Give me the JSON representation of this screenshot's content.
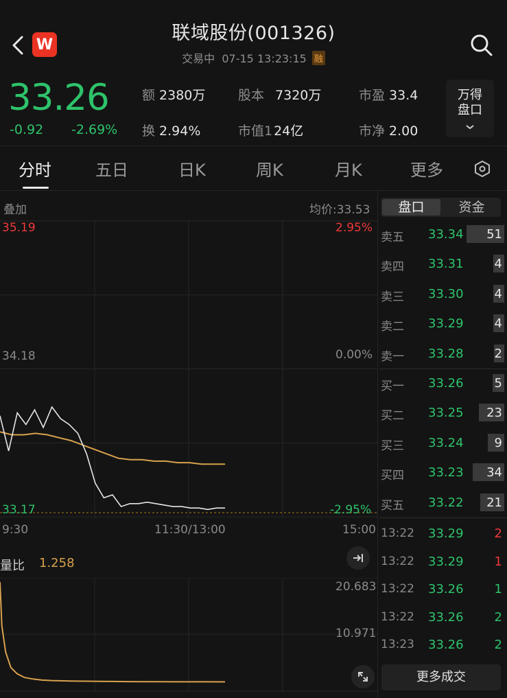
{
  "header": {
    "title": "联域股份(001326)",
    "status": "交易中",
    "datetime": "07-15 13:23:15",
    "margin_badge": "融",
    "logo_letter": "W"
  },
  "quote": {
    "price": "33.26",
    "change": "-0.92",
    "change_pct": "-2.69%",
    "stats": [
      {
        "label": "额",
        "value": "2380万"
      },
      {
        "label": "股本",
        "value": "7320万"
      },
      {
        "label": "市盈",
        "value": "33.4"
      },
      {
        "label": "换",
        "value": "2.94%"
      },
      {
        "label": "市值1",
        "value": "24亿"
      },
      {
        "label": "市净",
        "value": "2.00"
      }
    ],
    "pankou_button": {
      "line1": "万得",
      "line2": "盘口"
    }
  },
  "tabs": [
    "分时",
    "五日",
    "日K",
    "周K",
    "月K",
    "更多"
  ],
  "intraday": {
    "overlay_label": "叠加",
    "avg_price": "均价:33.53",
    "y_max": "35.19",
    "y_mid": "34.18",
    "y_min": "33.17",
    "pct_max": "2.95%",
    "pct_mid": "0.00%",
    "pct_min": "-2.95%",
    "time_start": "9:30",
    "time_mid": "11:30/13:00",
    "time_end": "15:00",
    "volume_ratio_label": "量比",
    "volume_ratio_value": "1.258",
    "vr_max": "20.683",
    "vr_mid": "10.971"
  },
  "chart_data": {
    "type": "line",
    "ylim": [
      33.17,
      35.19
    ],
    "series": [
      {
        "values": [
          33.86,
          33.62,
          33.88,
          33.8,
          33.9,
          33.78,
          33.92,
          33.84,
          33.8,
          33.74,
          33.6,
          33.4,
          33.3,
          33.32,
          33.24,
          33.26,
          33.26,
          33.27,
          33.26,
          33.25,
          33.24,
          33.24,
          33.23,
          33.23,
          33.22,
          33.23,
          33.23
        ]
      },
      {
        "values": [
          33.75,
          33.73,
          33.73,
          33.74,
          33.73,
          33.71,
          33.69,
          33.66,
          33.63,
          33.6,
          33.57,
          33.56,
          33.56,
          33.55,
          33.55,
          33.54,
          33.54,
          33.53,
          33.53,
          33.53
        ]
      }
    ],
    "volume_ratio": [
      20.4,
      12.0,
      7.0,
      4.0,
      2.8,
      2.1,
      1.8,
      1.6,
      1.5,
      1.45,
      1.4,
      1.38,
      1.35,
      1.33,
      1.3,
      1.29,
      1.28,
      1.27,
      1.26,
      1.26,
      1.258
    ],
    "vr_ylim": [
      0,
      20.683
    ]
  },
  "panel": {
    "tab_active": "盘口",
    "tab_other": "资金",
    "order_book": [
      {
        "label": "卖五",
        "price": "33.34",
        "vol": "51",
        "bar": 0.95
      },
      {
        "label": "卖四",
        "price": "33.31",
        "vol": "4",
        "bar": 0.28
      },
      {
        "label": "卖三",
        "price": "33.30",
        "vol": "4",
        "bar": 0.28
      },
      {
        "label": "卖二",
        "price": "33.29",
        "vol": "4",
        "bar": 0.28
      },
      {
        "label": "卖一",
        "price": "33.28",
        "vol": "2",
        "bar": 0.25
      },
      {
        "label": "买一",
        "price": "33.26",
        "vol": "5",
        "bar": 0.3
      },
      {
        "label": "买二",
        "price": "33.25",
        "vol": "23",
        "bar": 0.63
      },
      {
        "label": "买三",
        "price": "33.24",
        "vol": "9",
        "bar": 0.42
      },
      {
        "label": "买四",
        "price": "33.23",
        "vol": "34",
        "bar": 0.8
      },
      {
        "label": "买五",
        "price": "33.22",
        "vol": "21",
        "bar": 0.6
      }
    ],
    "trades": [
      {
        "time": "13:22",
        "price": "33.29",
        "vol": "2",
        "color": "#f0383a"
      },
      {
        "time": "13:22",
        "price": "33.29",
        "vol": "1",
        "color": "#f0383a"
      },
      {
        "time": "13:22",
        "price": "33.26",
        "vol": "1",
        "color": "#2ec36b"
      },
      {
        "time": "13:22",
        "price": "33.26",
        "vol": "2",
        "color": "#2ec36b"
      },
      {
        "time": "13:23",
        "price": "33.26",
        "vol": "2",
        "color": "#2ec36b"
      }
    ],
    "more_trades": "更多成交"
  },
  "colors": {
    "up": "#f0383a",
    "down": "#2ec36b",
    "avg": "#d9a24d",
    "price_line": "#e6e6e6"
  }
}
